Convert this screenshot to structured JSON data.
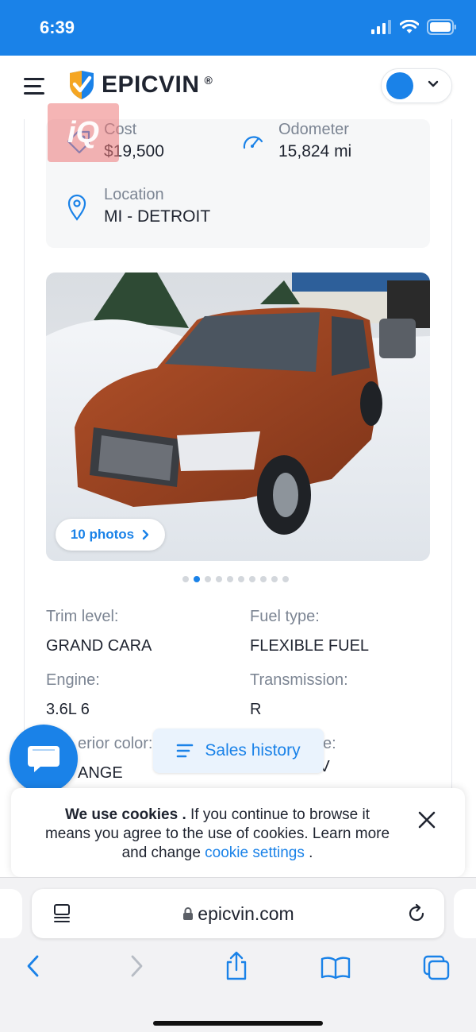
{
  "status_bar": {
    "time": "6:39"
  },
  "header": {
    "logo_text_primary": "EPIC",
    "logo_text_accent": "VIN",
    "logo_reg": "®"
  },
  "watermark": {
    "text": "iQ"
  },
  "info": {
    "cost_label": "Cost",
    "cost_value": "$19,500",
    "odometer_label": "Odometer",
    "odometer_value": "15,824 mi",
    "location_label": "Location",
    "location_value": "MI - DETROIT"
  },
  "gallery": {
    "photos_label": "10 photos",
    "dot_count": 10,
    "active_dot": 1
  },
  "specs": {
    "trim_label": "Trim level:",
    "trim_value": "GRAND CARA",
    "fuel_label": "Fuel type:",
    "fuel_value": "FLEXIBLE FUEL",
    "engine_label": "Engine:",
    "engine_value": "3.6L 6",
    "transmission_label": "Transmission:",
    "transmission_value": "R",
    "exterior_label_partial": "erior color:",
    "exterior_value_partial": "ANGE",
    "body_label_partial": "e:",
    "body_value_partial": "SPORTS V"
  },
  "floating": {
    "sales_history_label": "Sales history"
  },
  "cookie": {
    "bold_text": "We use cookies .",
    "text": " If you continue to browse it means you agree to the use of cookies. Learn more and change ",
    "link_text": "cookie settings",
    "end_text": " ."
  },
  "browser": {
    "url": "epicvin.com"
  },
  "colors": {
    "brand": "#1a82e8",
    "text": "#1f2430",
    "muted": "#7c8593"
  }
}
